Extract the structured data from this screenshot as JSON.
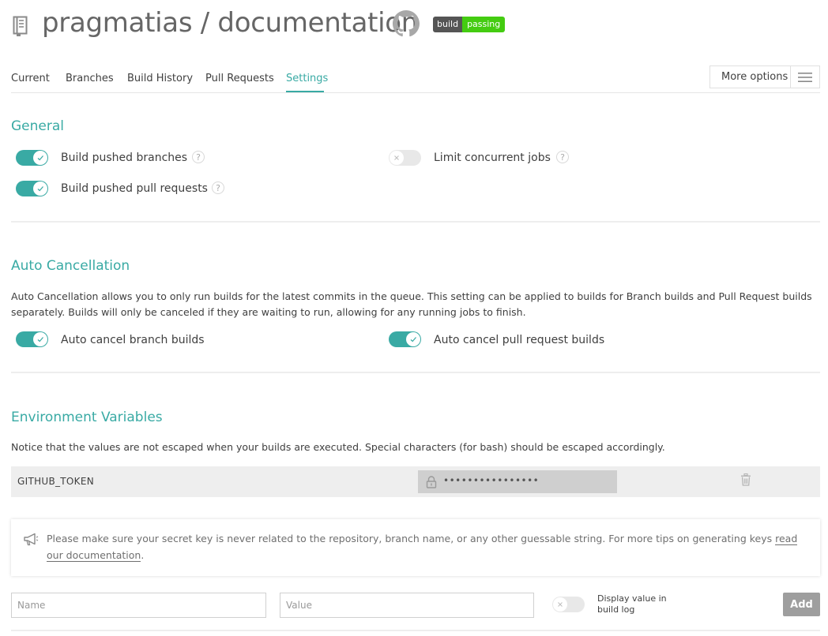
{
  "header": {
    "repo_title": "pragmatias / documentation",
    "badge": {
      "left": "build",
      "right": "passing",
      "right_color": "#44cc11"
    }
  },
  "tabs": [
    {
      "label": "Current",
      "active": false
    },
    {
      "label": "Branches",
      "active": false
    },
    {
      "label": "Build History",
      "active": false
    },
    {
      "label": "Pull Requests",
      "active": false
    },
    {
      "label": "Settings",
      "active": true
    }
  ],
  "more_options": {
    "label": "More options",
    "icon": "hamburger-icon"
  },
  "general": {
    "title": "General",
    "options": [
      {
        "label": "Build pushed branches",
        "on": true,
        "help": "?"
      },
      {
        "label": "Limit concurrent jobs",
        "on": false,
        "help": "?"
      },
      {
        "label": "Build pushed pull requests",
        "on": true,
        "help": "?"
      }
    ]
  },
  "auto_cancellation": {
    "title": "Auto Cancellation",
    "description": "Auto Cancellation allows you to only run builds for the latest commits in the queue. This setting can be applied to builds for Branch builds and Pull Request builds separately. Builds will only be canceled if they are waiting to run, allowing for any running jobs to finish.",
    "options": [
      {
        "label": "Auto cancel branch builds",
        "on": true
      },
      {
        "label": "Auto cancel pull request builds",
        "on": true
      }
    ]
  },
  "env_vars": {
    "title": "Environment Variables",
    "notice": "Notice that the values are not escaped when your builds are executed. Special characters (for bash) should be escaped accordingly.",
    "rows": [
      {
        "name": "GITHUB_TOKEN",
        "value": "••••••••••••••••"
      }
    ],
    "secret_notice": "Please make sure your secret key is never related to the repository, branch name, or any other guessable string. For more tips on generating keys ",
    "secret_link": "read our documentation",
    "secret_end": ".",
    "form": {
      "name_placeholder": "Name",
      "value_placeholder": "Value",
      "display_label": "Display value in build log",
      "display_on": false,
      "add_label": "Add"
    }
  },
  "colors": {
    "accent": "#39aaa4",
    "text": "#3f3f3f"
  }
}
